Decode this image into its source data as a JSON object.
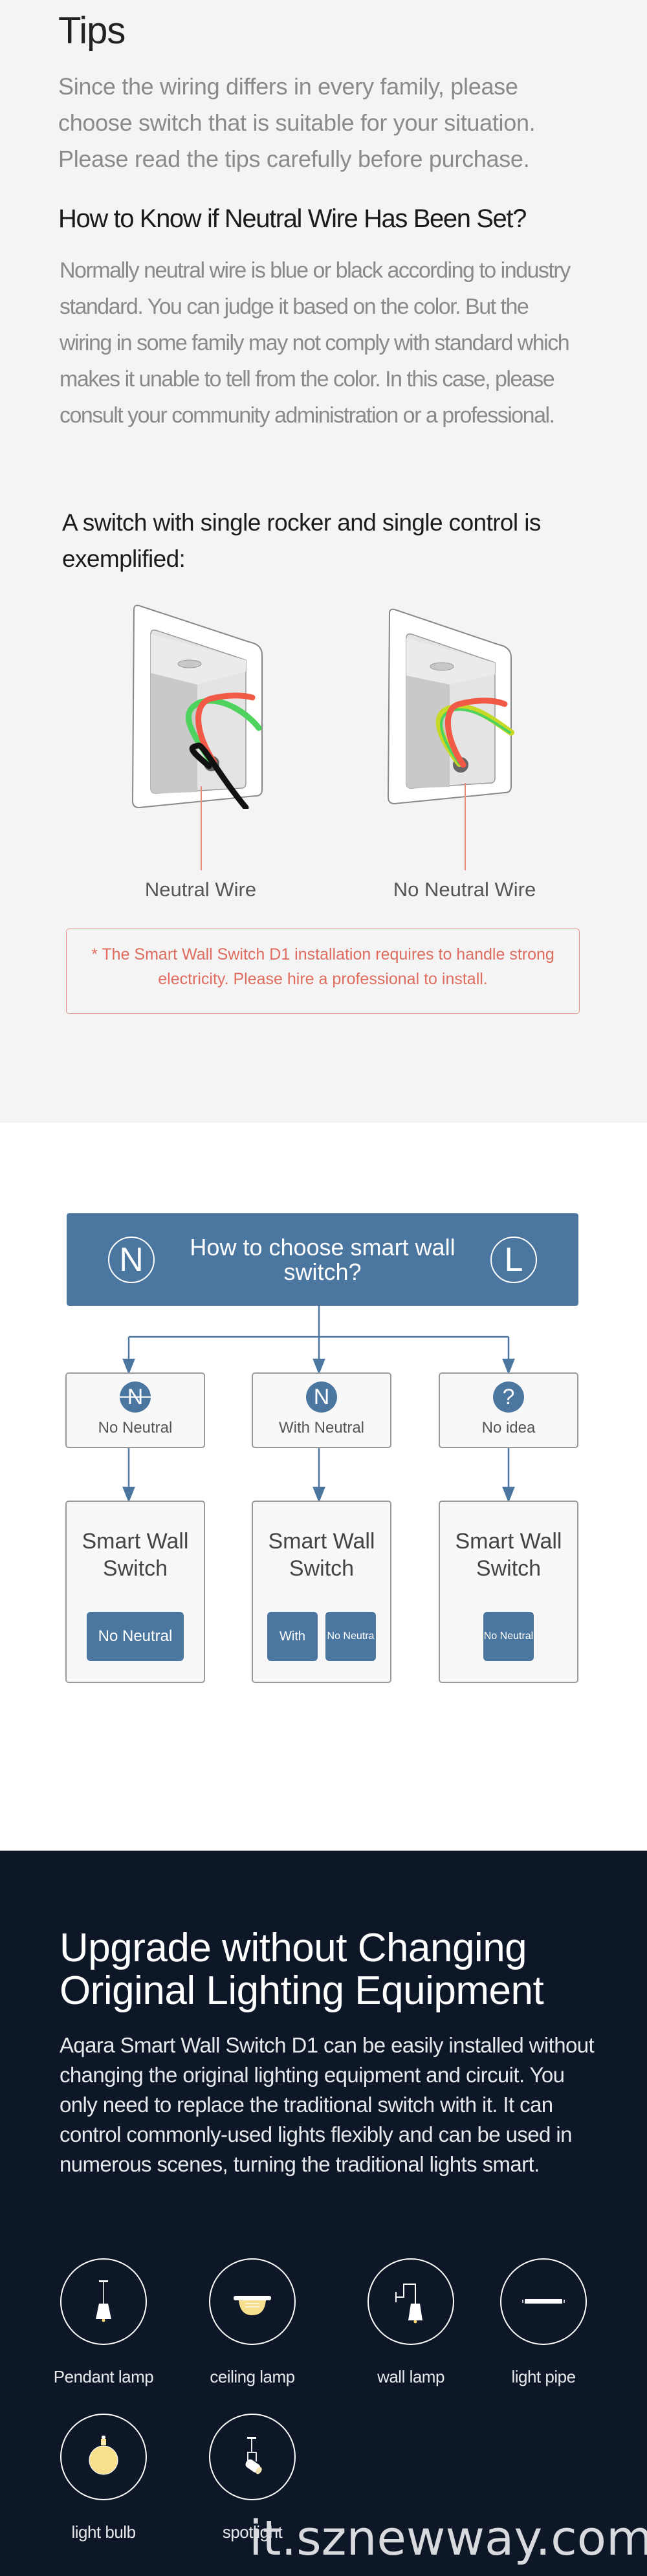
{
  "tips": {
    "title": "Tips",
    "intro": "Since the wiring differs in every family, please choose switch that is suitable for your situation. Please read the tips carefully before purchase.",
    "neutral_heading": "How to Know if Neutral Wire Has Been Set?",
    "neutral_body": "Normally neutral wire is blue or black according to industry standard. You can judge it based on the color. But the wiring in some family may not comply with standard which makes it unable to tell from the color. In this case, please consult your community administration or a professional.",
    "example_heading": "A switch with single rocker and single control is exemplified:",
    "diagrams": [
      {
        "label": "Neutral Wire",
        "wires": [
          "red",
          "green",
          "black"
        ]
      },
      {
        "label": "No Neutral Wire",
        "wires": [
          "red",
          "yellow-green"
        ]
      }
    ],
    "warning": "* The Smart Wall Switch D1 installation requires to handle strong electricity. Please hire a professional to install."
  },
  "flowchart": {
    "title": "How to choose smart wall switch?",
    "left_badge": "N",
    "right_badge": "L",
    "categories": [
      {
        "icon": "N",
        "icon_name": "no-neutral-icon",
        "label": "No Neutral"
      },
      {
        "icon": "N",
        "icon_name": "with-neutral-icon",
        "label": "With Neutral"
      },
      {
        "icon": "?",
        "icon_name": "question-icon",
        "label": "No idea"
      }
    ],
    "products": [
      {
        "title": "Smart Wall Switch",
        "buttons": [
          "No Neutral"
        ]
      },
      {
        "title": "Smart Wall Switch",
        "buttons": [
          "With",
          "No Neutra"
        ]
      },
      {
        "title": "Smart Wall Switch",
        "buttons": [
          "No Neutral"
        ]
      }
    ]
  },
  "upgrade": {
    "title": "Upgrade without Changing Original Lighting Equipment",
    "description": "Aqara Smart Wall Switch D1 can be easily installed without changing the original lighting equipment and circuit. You only need to replace the traditional switch with it. It can control commonly-used lights flexibly and can be used in numerous scenes, turning the traditional lights smart.",
    "lamps": [
      {
        "icon": "pendant-lamp-icon",
        "label": "Pendant lamp"
      },
      {
        "icon": "ceiling-lamp-icon",
        "label": "ceiling lamp"
      },
      {
        "icon": "wall-lamp-icon",
        "label": "wall lamp"
      },
      {
        "icon": "light-pipe-icon",
        "label": "light pipe"
      },
      {
        "icon": "light-bulb-icon",
        "label": "light bulb"
      },
      {
        "icon": "spotlight-icon",
        "label": "spotlight"
      }
    ]
  },
  "watermark": "it.sznewway.com",
  "colors": {
    "accent_blue": "#4b76a0",
    "warning_red": "#df6c5e",
    "dark_bg": "#0d1727",
    "light_bg": "#f4f4f4"
  }
}
